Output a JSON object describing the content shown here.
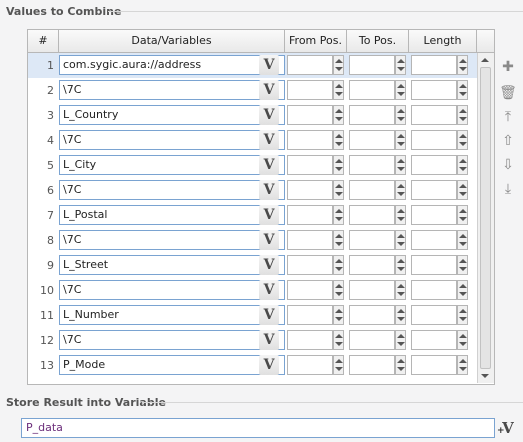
{
  "values_section": {
    "title": "Values to Combine"
  },
  "columns": {
    "num": "#",
    "data": "Data/Variables",
    "from": "From Pos.",
    "to": "To Pos.",
    "length": "Length"
  },
  "rows": [
    {
      "n": "1",
      "value": "com.sygic.aura://address"
    },
    {
      "n": "2",
      "value": "\\7C"
    },
    {
      "n": "3",
      "value": "L_Country"
    },
    {
      "n": "4",
      "value": "\\7C"
    },
    {
      "n": "5",
      "value": "L_City"
    },
    {
      "n": "6",
      "value": "\\7C"
    },
    {
      "n": "7",
      "value": "L_Postal"
    },
    {
      "n": "8",
      "value": "\\7C"
    },
    {
      "n": "9",
      "value": "L_Street"
    },
    {
      "n": "10",
      "value": "\\7C"
    },
    {
      "n": "11",
      "value": "L_Number"
    },
    {
      "n": "12",
      "value": "\\7C"
    },
    {
      "n": "13",
      "value": "P_Mode"
    }
  ],
  "selected_row": 1,
  "variable_button_glyph": "V",
  "side_toolbar": [
    {
      "icon": "add-icon",
      "glyph": "✚"
    },
    {
      "icon": "delete-icon",
      "glyph": "🗑"
    },
    {
      "icon": "move-top-icon",
      "glyph": "⤒"
    },
    {
      "icon": "move-up-icon",
      "glyph": "⇧"
    },
    {
      "icon": "move-down-icon",
      "glyph": "⇩"
    },
    {
      "icon": "move-bottom-icon",
      "glyph": "⤓"
    }
  ],
  "store_section": {
    "title": "Store Result into Variable",
    "value": "P_data",
    "button_glyph": "V",
    "button_plus": "+"
  }
}
